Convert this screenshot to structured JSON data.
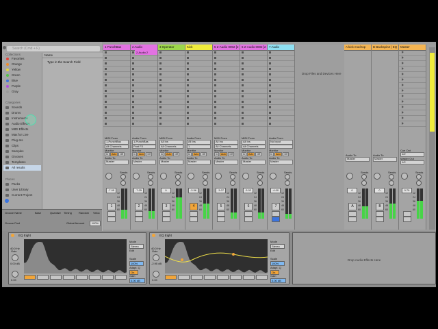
{
  "browser": {
    "search_placeholder": "Search (Cmd + F)",
    "collections_header": "Collections",
    "collections": [
      {
        "label": "Favorites",
        "color": "#e4453a"
      },
      {
        "label": "Orange",
        "color": "#f08c2c"
      },
      {
        "label": "Yellow",
        "color": "#e5d83a"
      },
      {
        "label": "Green",
        "color": "#53c447"
      },
      {
        "label": "Blue",
        "color": "#3b74e0"
      },
      {
        "label": "Purple",
        "color": "#b24fe0"
      },
      {
        "label": "Gray",
        "color": "#9b9b9b"
      }
    ],
    "categories_header": "Categories",
    "categories": [
      "Sounds",
      "Drums",
      "Instruments",
      "Audio Effects",
      "MIDI Effects",
      "Max for Live",
      "Plug-Ins",
      "Clips",
      "Samples",
      "Grooves",
      "Templates",
      "All results"
    ],
    "places_header": "Places",
    "places": [
      "Packs",
      "User Library",
      "Current Project"
    ],
    "name_header": "Name",
    "hint": "Type in the Search Field"
  },
  "groove": {
    "cols": [
      "Groove Name",
      "Base",
      "Quantize",
      "Timing",
      "Random",
      "Veloc"
    ],
    "pool_label": "Groove Pool",
    "global_label": "Global Amount",
    "global_value": "100%"
  },
  "tracks": [
    {
      "name": "1 PunchBas",
      "color": "#e272e2",
      "clip": "",
      "in_from": "1-PunchBas",
      "in_type": "All Channels",
      "from_label": "MIDI From",
      "vol": "-7.05",
      "num": "1",
      "active": false,
      "level": 0.3
    },
    {
      "name": "2 Audio",
      "color": "#e272e2",
      "clip": "2-Audio 2",
      "in_from": "1-PunchBas",
      "in_type": "Post FX",
      "from_label": "Audio From",
      "vol": "-7.05",
      "num": "2",
      "active": false,
      "level": 0.25
    },
    {
      "name": "3 Operator",
      "color": "#9cd64a",
      "clip": "",
      "in_from": "All Ins",
      "in_type": "All Channels",
      "from_label": "MIDI From",
      "vol": "0",
      "num": "3",
      "active": false,
      "level": 0.7
    },
    {
      "name": "Kick",
      "color": "#f0ec3c",
      "clip": "",
      "in_from": "All Ins",
      "in_type": "1",
      "from_label": "Audio From",
      "vol": "-3.56",
      "num": "4",
      "active": true,
      "level": 0.5
    },
    {
      "name": "5 2-Audio 0002 [2",
      "color": "#e272e2",
      "clip": "",
      "in_from": "All Ins",
      "in_type": "All Channels",
      "from_label": "MIDI From",
      "vol": "-3.07",
      "num": "5",
      "active": false,
      "level": 0.2
    },
    {
      "name": "6 2-Audio 0002 [2",
      "color": "#e272e2",
      "clip": "",
      "in_from": "All Ins",
      "in_type": "All Channels",
      "from_label": "MIDI From",
      "vol": "-3.02",
      "num": "6",
      "active": false,
      "level": 0.2
    },
    {
      "name": "7 Audio",
      "color": "#8fe0f2",
      "clip": "",
      "in_from": "No Input",
      "in_type": "",
      "from_label": "Audio From",
      "vol": "-4.00",
      "num": "7",
      "active": false,
      "level": 0.15
    }
  ],
  "returns": [
    {
      "name": "A kick mod top",
      "color": "#f4b452",
      "vol": "0",
      "num": "A",
      "level": 0.4
    },
    {
      "name": "B Backspin2 | EQ",
      "color": "#f4b452",
      "vol": "0",
      "num": "B",
      "level": 0.5
    }
  ],
  "master": {
    "name": "Master",
    "color": "#f4b452",
    "vol": "0.79",
    "level": 0.6,
    "cue_label": "Cue Out",
    "cue_value": "1/2",
    "out_label": "Master Out",
    "out_value": "1/2"
  },
  "labels": {
    "monitor": "Monitor",
    "in": "In",
    "auto": "Auto",
    "off": "Off",
    "audio_to": "Audio To",
    "master": "Master",
    "kick": "Kick",
    "sends": "Sends",
    "post": "Post",
    "drop_files": "Drop Files and Devices Here",
    "drop_effects": "Drop Audio Effects Here"
  },
  "devices": [
    {
      "title": "EQ Eight",
      "gain_label": "Gain",
      "gain_value": "0.00 dB",
      "freq_value": "40.0 Hz",
      "mode_label": "Mode",
      "mode_value": "Stereo",
      "edit_label": "Edit",
      "scale_label": "Scale",
      "scale_value": "100%",
      "adapt_label": "Adapt. Q",
      "adapt_value": "On",
      "out_label": "Gain",
      "out_value": "0.00 dB",
      "q_value": "0.09"
    },
    {
      "title": "EQ Eight",
      "gain_label": "Gain",
      "gain_value": "-2.95 dB",
      "freq_value": "40.0 Hz",
      "mode_label": "Mode",
      "mode_value": "Stereo",
      "edit_label": "Edit",
      "scale_label": "Scale",
      "scale_value": "100%",
      "adapt_label": "Adapt. Q",
      "adapt_value": "On",
      "out_label": "Gain",
      "out_value": "0.00 dB",
      "q_value": "3.09"
    }
  ]
}
